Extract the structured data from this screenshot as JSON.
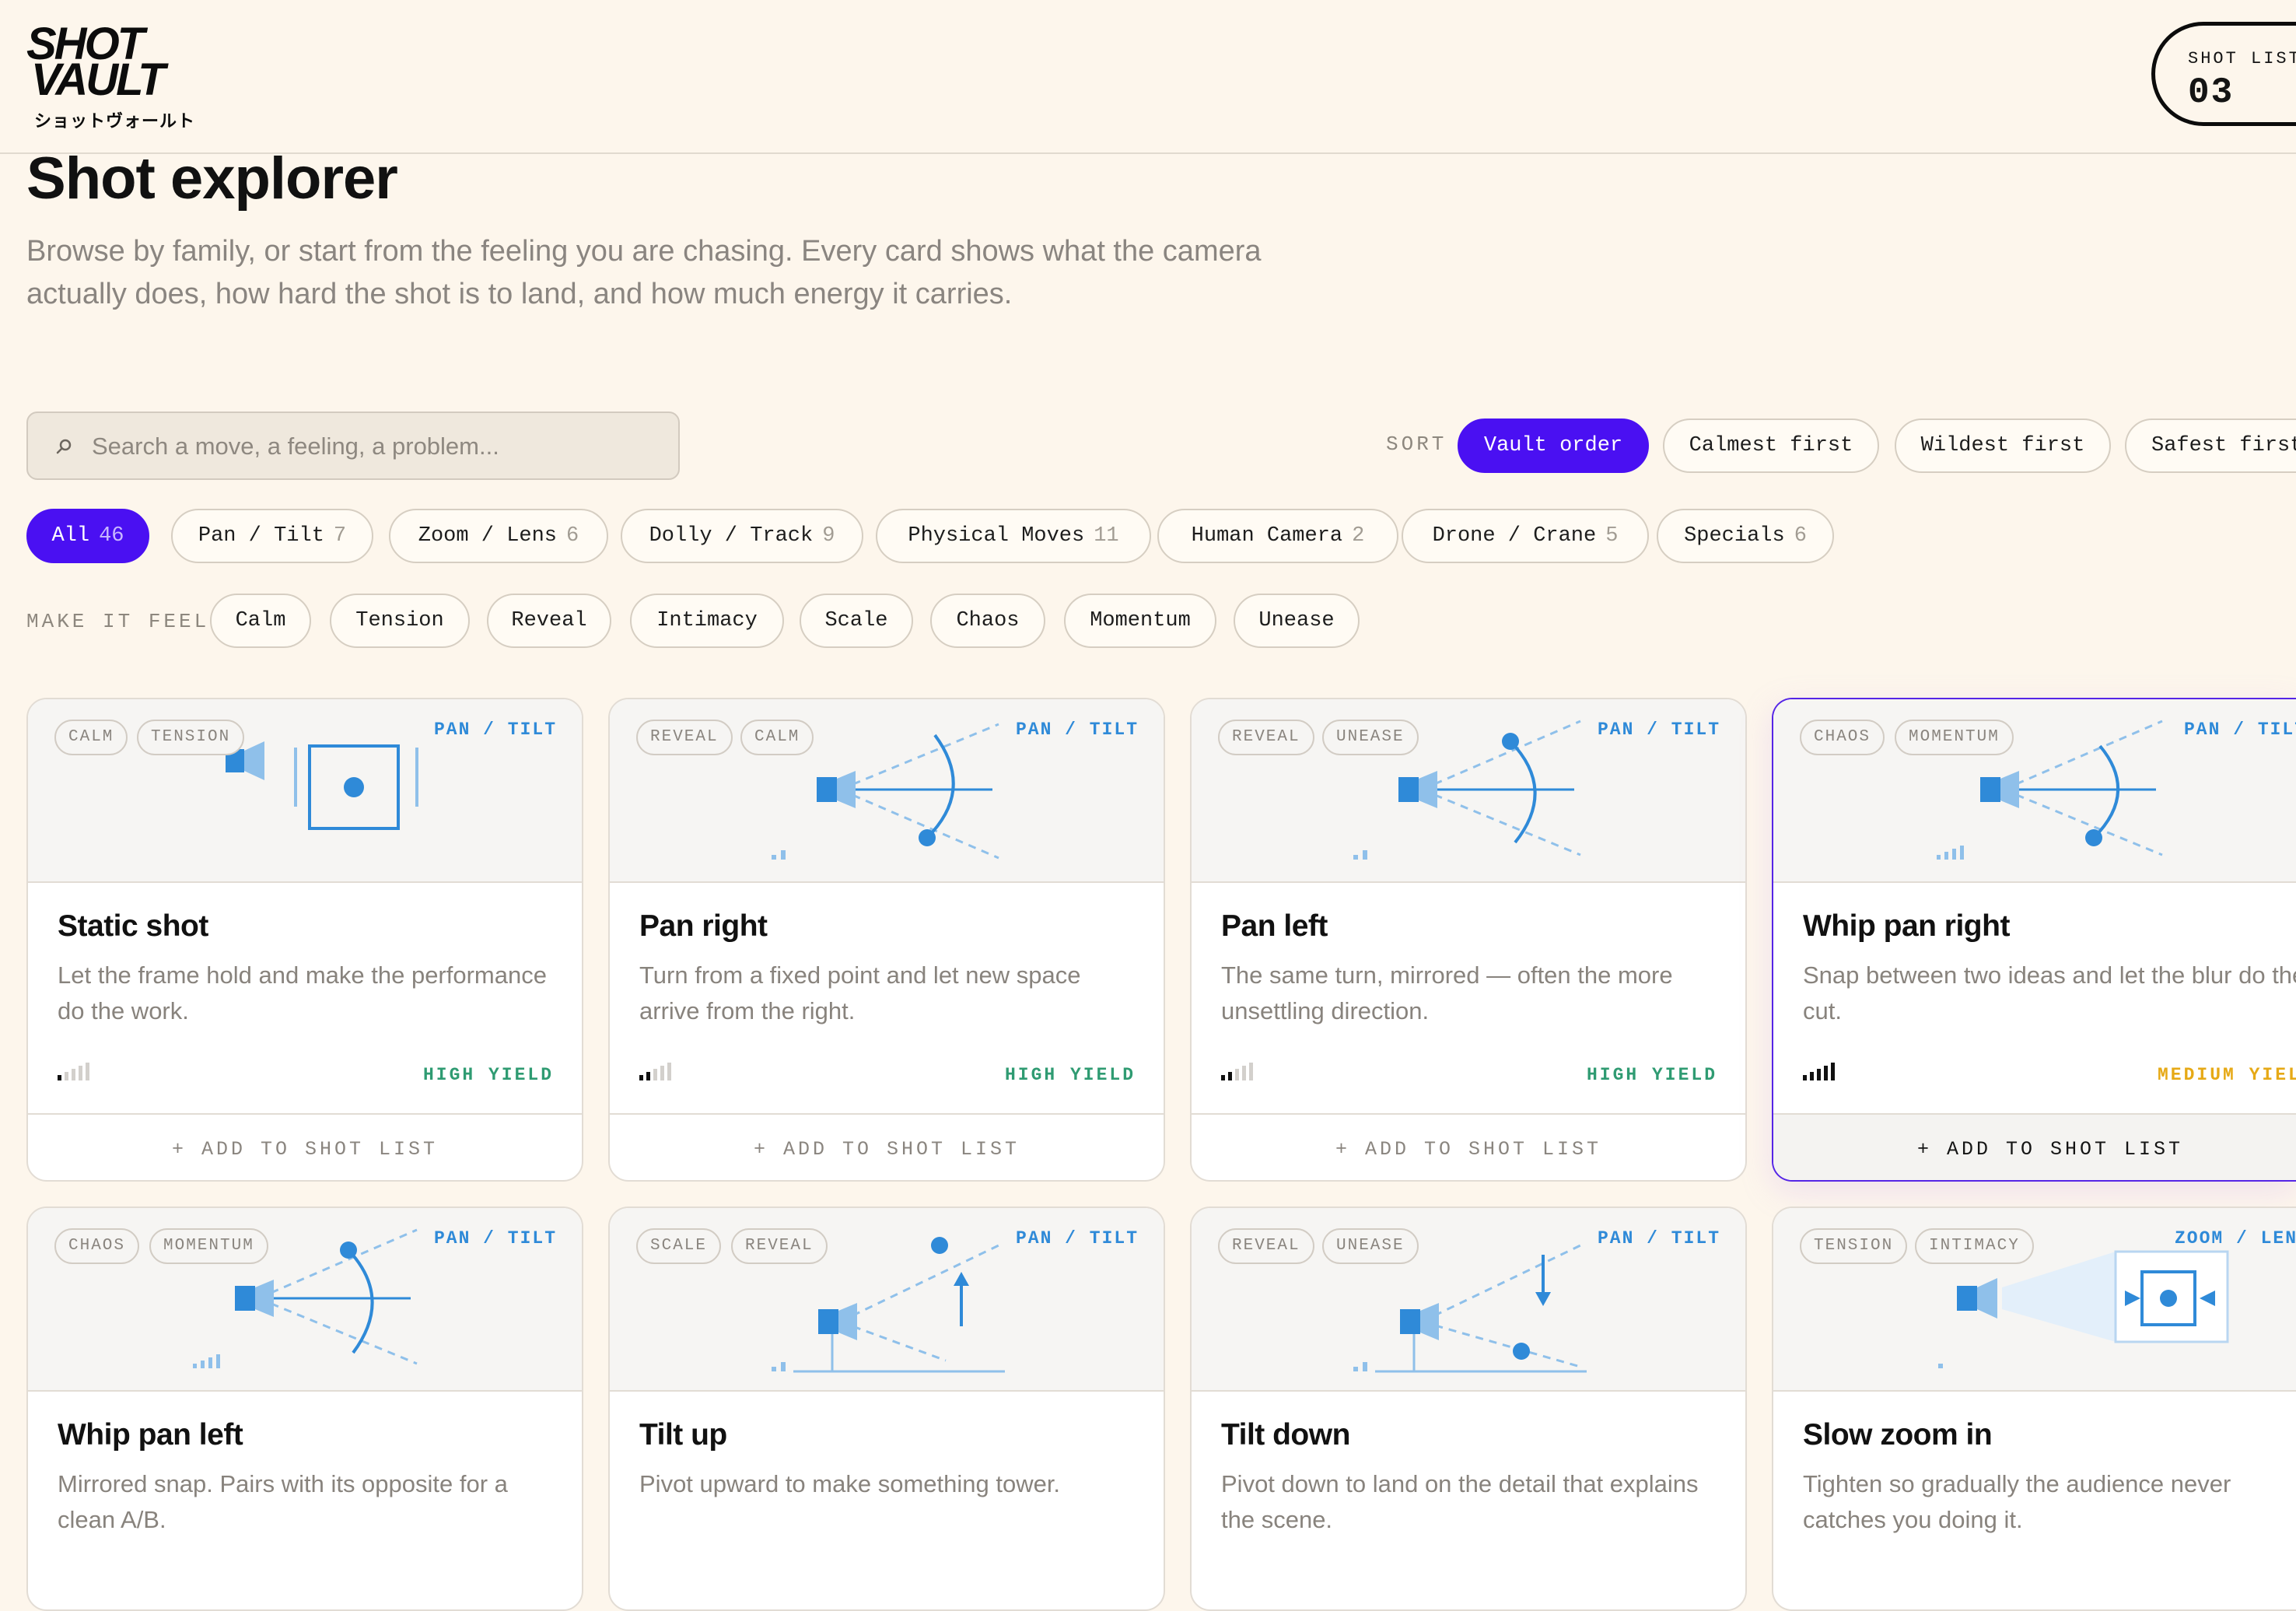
{
  "brand": {
    "name_line1": "SHOT",
    "name_line2": "VAULT",
    "name_jp": "ショットヴォールト"
  },
  "shot_list": {
    "label": "SHOT LIST",
    "count": "03"
  },
  "intro": {
    "title": "Shot explorer",
    "description": "Browse by family, or start from the feeling you are chasing. Every card shows what the camera actually does, how hard the shot is to land, and how much energy it carries."
  },
  "search": {
    "placeholder": "Search a move, a feeling, a problem...",
    "value": ""
  },
  "sort": {
    "label": "SORT",
    "options": [
      "Vault order",
      "Calmest first",
      "Wildest first",
      "Safest first"
    ],
    "selected": "Vault order"
  },
  "families": [
    {
      "label": "All",
      "count": "46",
      "active": true
    },
    {
      "label": "Pan / Tilt",
      "count": "7"
    },
    {
      "label": "Zoom / Lens",
      "count": "6"
    },
    {
      "label": "Dolly / Track",
      "count": "9"
    },
    {
      "label": "Physical Moves",
      "count": "11"
    },
    {
      "label": "Human Camera",
      "count": "2"
    },
    {
      "label": "Drone / Crane",
      "count": "5"
    },
    {
      "label": "Specials",
      "count": "6"
    }
  ],
  "feel": {
    "label": "MAKE IT FEEL",
    "options": [
      "Calm",
      "Tension",
      "Reveal",
      "Intimacy",
      "Scale",
      "Chaos",
      "Momentum",
      "Unease"
    ]
  },
  "colors": {
    "accent": "#4a10f2",
    "diagram_blue": "#2f8ad8",
    "high_yield": "#2f9b72",
    "medium_yield": "#e6a916"
  },
  "cards": [
    {
      "title": "Static shot",
      "family": "PAN / TILT",
      "tags": [
        "CALM",
        "TENSION"
      ],
      "description": "Let the frame hold and make the performance do the work.",
      "difficulty": 1,
      "yield": "HIGH YIELD",
      "add_label": "+ ADD TO SHOT LIST",
      "diagram": "static-diagram-icon"
    },
    {
      "title": "Pan right",
      "family": "PAN / TILT",
      "tags": [
        "REVEAL",
        "CALM"
      ],
      "description": "Turn from a fixed point and let new space arrive from the right.",
      "difficulty": 2,
      "energy": 2,
      "yield": "HIGH YIELD",
      "add_label": "+ ADD TO SHOT LIST",
      "diagram": "pan-right-diagram-icon"
    },
    {
      "title": "Pan left",
      "family": "PAN / TILT",
      "tags": [
        "REVEAL",
        "UNEASE"
      ],
      "description": "The same turn, mirrored — often the more unsettling direction.",
      "difficulty": 2,
      "energy": 2,
      "yield": "HIGH YIELD",
      "add_label": "+ ADD TO SHOT LIST",
      "diagram": "pan-left-diagram-icon"
    },
    {
      "title": "Whip pan right",
      "family": "PAN / TILT",
      "tags": [
        "CHAOS",
        "MOMENTUM"
      ],
      "description": "Snap between two ideas and let the blur do the cut.",
      "difficulty": 5,
      "energy": 4,
      "yield": "MEDIUM YIELD",
      "add_label": "+ ADD TO SHOT LIST",
      "selected": true,
      "diagram": "whip-pan-right-diagram-icon"
    },
    {
      "title": "Whip pan left",
      "family": "PAN / TILT",
      "tags": [
        "CHAOS",
        "MOMENTUM"
      ],
      "description": "Mirrored snap. Pairs with its opposite for a clean A/B.",
      "energy": 4,
      "diagram": "whip-pan-left-diagram-icon"
    },
    {
      "title": "Tilt up",
      "family": "PAN / TILT",
      "tags": [
        "SCALE",
        "REVEAL"
      ],
      "description": "Pivot upward to make something tower.",
      "energy": 2,
      "diagram": "tilt-up-diagram-icon"
    },
    {
      "title": "Tilt down",
      "family": "PAN / TILT",
      "tags": [
        "REVEAL",
        "UNEASE"
      ],
      "description": "Pivot down to land on the detail that explains the scene.",
      "energy": 2,
      "diagram": "tilt-down-diagram-icon"
    },
    {
      "title": "Slow zoom in",
      "family": "ZOOM / LENS",
      "tags": [
        "TENSION",
        "INTIMACY"
      ],
      "description": "Tighten so gradually the audience never catches you doing it.",
      "energy": 1,
      "diagram": "slow-zoom-in-diagram-icon"
    }
  ]
}
